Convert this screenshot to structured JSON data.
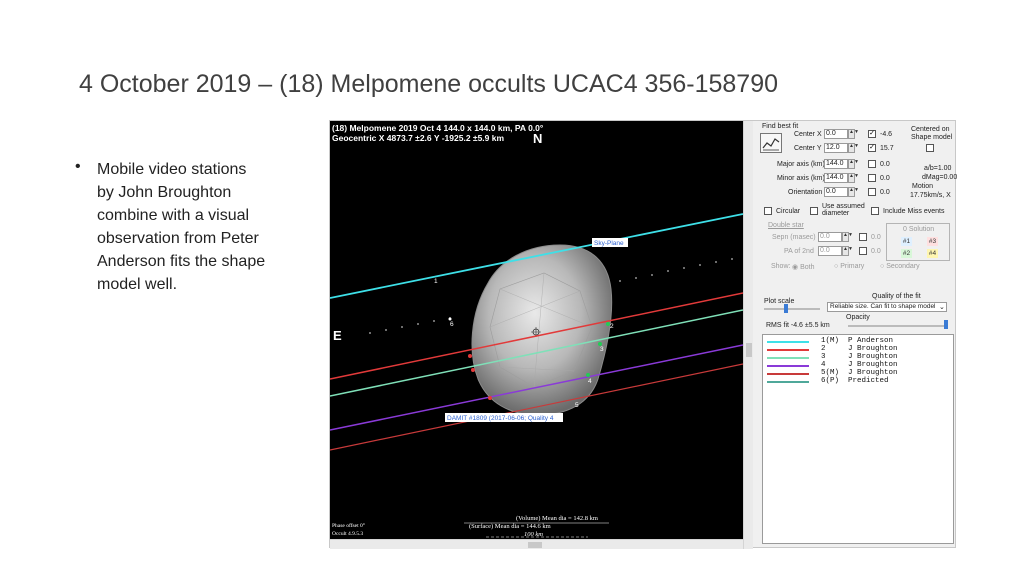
{
  "slide": {
    "title": "4 October 2019 – (18) Melpomene occults UCAC4 356-158790",
    "bullet_symbol": "•",
    "bullet_text": "Mobile video stations by John Broughton combine with a visual observation from Peter Anderson fits the shape model well."
  },
  "plot": {
    "header_line1": "(18) Melpomene  2019 Oct 4   144.0 x 144.0 km, PA 0.0°",
    "header_line2": "Geocentric  X  4873.7 ±2.6  Y  -1925.2 ±5.9 km",
    "north_label": "N",
    "east_label": "E",
    "skyplane_label": "Sky-Plane",
    "damit_label": "DAMIT #1809 (2017-06-06; Quality 4",
    "chord_labels": [
      "1",
      "2",
      "3",
      "4",
      "5",
      "6"
    ],
    "volume_label": "(Volume) Mean dia = 142.8 km",
    "surface_label": "(Surface) Mean dia = 144.6 km",
    "scale_label": "100 km",
    "footer_line1": "Phase offset 0°",
    "footer_line2": "Occult 4.9.5.3",
    "line_colors": {
      "anderson": "#3ee0e8",
      "broughton2": "#e23a3a",
      "broughton3": "#7fe0b8",
      "broughton4": "#8a3ad8",
      "broughton5": "#c83a3a",
      "predicted": "#4fa89a"
    }
  },
  "panel": {
    "find_best_fit": "Find best fit",
    "center_x_label": "Center X",
    "center_x_value": "0.0",
    "center_x_step": "-4.6",
    "center_y_label": "Center Y",
    "center_y_value": "12.0",
    "center_y_step": "15.7",
    "centered_on_shape": "Centered on\nShape model",
    "major_axis_label": "Major axis (km)",
    "major_axis_value": "144.0",
    "major_axis_step": "0.0",
    "minor_axis_label": "Minor axis (km)",
    "minor_axis_value": "144.0",
    "minor_axis_step": "0.0",
    "orientation_label": "Orientation",
    "orientation_value": "0.0",
    "orientation_step": "0.0",
    "ab_ratio": "a/b=1.00",
    "dmag": "dMag=0.00",
    "motion_label": "Motion",
    "motion_value": "17.75km/s, X",
    "circular_label": "Circular",
    "use_assumed_diameter": "Use assumed\ndiameter",
    "include_miss_events": "Include Miss events",
    "double_star": "Double star",
    "sepn_label": "Sepn (masec)",
    "sepn_value": "0.0",
    "sepn_step": "0.0",
    "pa_2nd_label": "PA of 2nd",
    "pa_2nd_value": "0.0",
    "pa_2nd_step": "0.0",
    "show_label": "Show:",
    "show_options": [
      "Both",
      "Primary",
      "Secondary"
    ],
    "solution_label": "0 Solution",
    "solution_chips": [
      "#1",
      "#3",
      "#2",
      "#4"
    ],
    "quality_label": "Quality of the fit",
    "plot_scale_label": "Plot scale",
    "quality_value": "Reliable size. Can fit to shape model",
    "opacity_label": "Opacity",
    "rms_fit": "RMS fit -4.6 ±5.5 km",
    "legend": [
      {
        "num": "1(M)",
        "name": "P Anderson",
        "color": "#3ee0e8"
      },
      {
        "num": "2",
        "name": "J Broughton",
        "color": "#e23a3a"
      },
      {
        "num": "3",
        "name": "J Broughton",
        "color": "#7fe0b8"
      },
      {
        "num": "4",
        "name": "J Broughton",
        "color": "#8a3ad8"
      },
      {
        "num": "5(M)",
        "name": "J Broughton",
        "color": "#c83a3a"
      },
      {
        "num": "6(P)",
        "name": "Predicted",
        "color": "#4fa89a"
      }
    ]
  }
}
